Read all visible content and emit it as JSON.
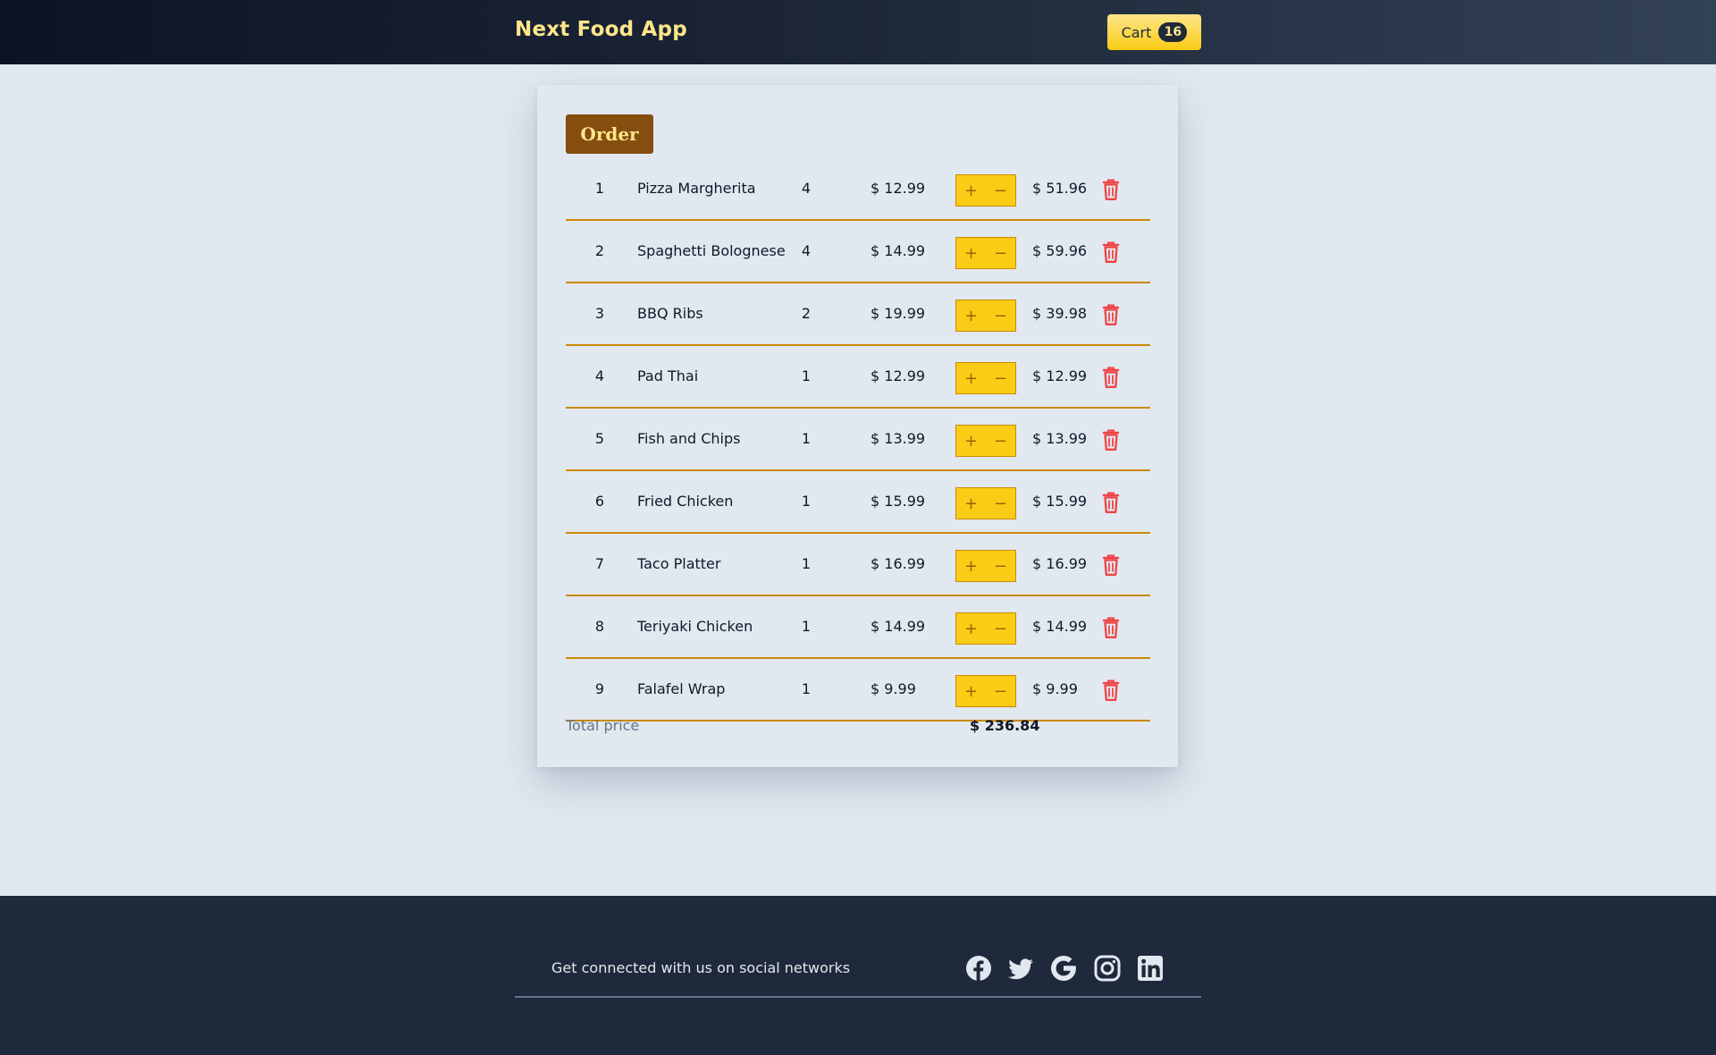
{
  "header": {
    "brand": "Next Food App",
    "cart_label": "Cart",
    "cart_count": "16"
  },
  "order": {
    "title": "Order",
    "items": [
      {
        "index": "1",
        "name": "Pizza Margherita",
        "qty": "4",
        "price": "$ 12.99",
        "subtotal": "$ 51.96"
      },
      {
        "index": "2",
        "name": "Spaghetti Bolognese",
        "qty": "4",
        "price": "$ 14.99",
        "subtotal": "$ 59.96"
      },
      {
        "index": "3",
        "name": "BBQ Ribs",
        "qty": "2",
        "price": "$ 19.99",
        "subtotal": "$ 39.98"
      },
      {
        "index": "4",
        "name": "Pad Thai",
        "qty": "1",
        "price": "$ 12.99",
        "subtotal": "$ 12.99"
      },
      {
        "index": "5",
        "name": "Fish and Chips",
        "qty": "1",
        "price": "$ 13.99",
        "subtotal": "$ 13.99"
      },
      {
        "index": "6",
        "name": "Fried Chicken",
        "qty": "1",
        "price": "$ 15.99",
        "subtotal": "$ 15.99"
      },
      {
        "index": "7",
        "name": "Taco Platter",
        "qty": "1",
        "price": "$ 16.99",
        "subtotal": "$ 16.99"
      },
      {
        "index": "8",
        "name": "Teriyaki Chicken",
        "qty": "1",
        "price": "$ 14.99",
        "subtotal": "$ 14.99"
      },
      {
        "index": "9",
        "name": "Falafel Wrap",
        "qty": "1",
        "price": "$ 9.99",
        "subtotal": "$ 9.99"
      }
    ],
    "stepper": {
      "plus": "+",
      "minus": "−"
    },
    "total_label": "Total price",
    "total_value": "$ 236.84"
  },
  "footer": {
    "text": "Get connected with us on social networks",
    "social_icons": [
      "facebook-icon",
      "twitter-icon",
      "google-icon",
      "instagram-icon",
      "linkedin-icon"
    ]
  },
  "colors": {
    "header_gradient_start": "#0b1426",
    "header_gradient_end": "#334155",
    "brand_text": "#fde68a",
    "cart_button": "#facc15",
    "order_badge": "#854d0e",
    "row_divider": "#ca8a04",
    "stepper_bg": "#facc15",
    "trash": "#ef4444",
    "page_bg": "#e2e8f0",
    "footer_bg": "#1e293b"
  }
}
